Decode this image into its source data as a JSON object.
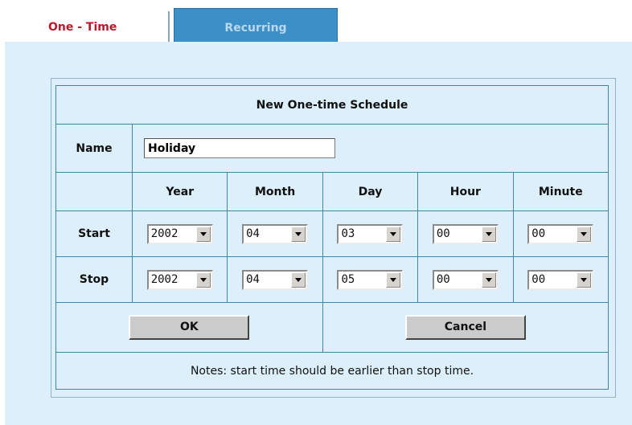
{
  "tabs": {
    "one_time": "One - Time",
    "recurring": "Recurring"
  },
  "schedule": {
    "title": "New One-time Schedule",
    "name_label": "Name",
    "name_value": "Holiday",
    "columns": [
      "Year",
      "Month",
      "Day",
      "Hour",
      "Minute"
    ],
    "start_label": "Start",
    "stop_label": "Stop",
    "start": {
      "year": "2002",
      "month": "04",
      "day": "03",
      "hour": "00",
      "minute": "00"
    },
    "stop": {
      "year": "2002",
      "month": "04",
      "day": "05",
      "hour": "00",
      "minute": "00"
    },
    "ok_label": "OK",
    "cancel_label": "Cancel",
    "notes": "Notes: start time should be earlier than stop time."
  },
  "colors": {
    "panel": "#dceffa",
    "border": "#3f86ad",
    "active_tab_text": "#c0162c",
    "inactive_tab": "#3d8fc8"
  }
}
